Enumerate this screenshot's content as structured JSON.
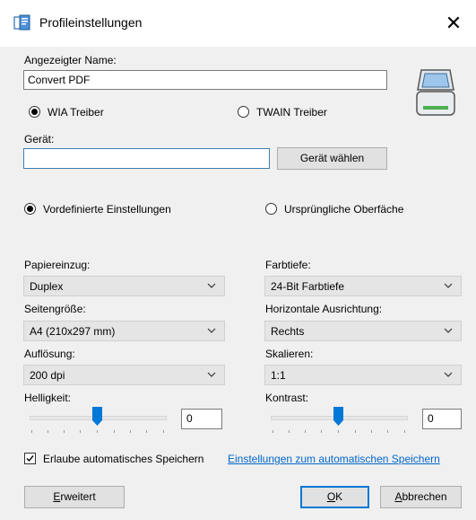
{
  "window": {
    "title": "Profileinstellungen",
    "close_glyph": "✕"
  },
  "display_name": {
    "label": "Angezeigter Name:",
    "value": "Convert PDF"
  },
  "driver": {
    "wia_label": "WIA Treiber",
    "twain_label": "TWAIN Treiber",
    "selected": "WIA"
  },
  "device": {
    "label": "Gerät:",
    "value": "",
    "choose_button": "Gerät wählen"
  },
  "mode": {
    "predefined_label": "Vordefinierte Einstellungen",
    "native_label": "Ursprüngliche Oberfäche",
    "selected": "predefined"
  },
  "settings": {
    "feed_label": "Papiereinzug:",
    "feed_value": "Duplex",
    "color_label": "Farbtiefe:",
    "color_value": "24-Bit Farbtiefe",
    "page_size_label": "Seitengröße:",
    "page_size_value": "A4 (210x297 mm)",
    "halign_label": "Horizontale Ausrichtung:",
    "halign_value": "Rechts",
    "resolution_label": "Auflösung:",
    "resolution_value": "200 dpi",
    "scale_label": "Skalieren:",
    "scale_value": "1:1",
    "brightness_label": "Helligkeit:",
    "brightness_value": "0",
    "brightness_level": 0.5,
    "contrast_label": "Kontrast:",
    "contrast_value": "0",
    "contrast_level": 0.5
  },
  "autosave": {
    "checked": true,
    "label": "Erlaube automatisches Speichern",
    "link": "Einstellungen zum automatischen Speichern"
  },
  "buttons": {
    "advanced": "Erweitert",
    "advanced_rest": "rweitert",
    "advanced_key": "E",
    "ok": "OK",
    "ok_key": "O",
    "ok_rest": "K",
    "cancel": "Abbrechen",
    "cancel_key": "A",
    "cancel_rest": "bbrechen"
  },
  "colors": {
    "accent": "#0078d7",
    "link": "#0066cc",
    "field_border_blue": "#3c7fb1"
  },
  "icons": {
    "title": "scanner-profile-icon",
    "scanner": "scanner-icon",
    "chevron": "chevron-down-icon"
  }
}
